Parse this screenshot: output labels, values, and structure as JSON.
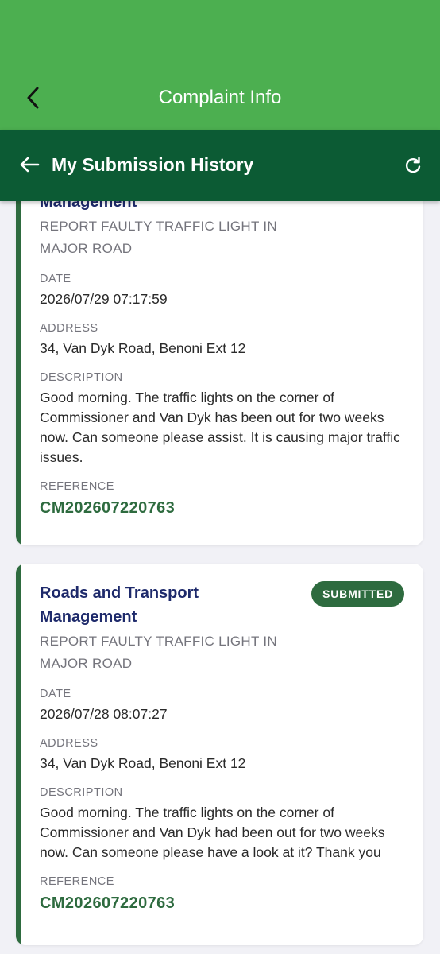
{
  "header": {
    "title": "Complaint Info"
  },
  "subheader": {
    "title": "My Submission History"
  },
  "labels": {
    "date": "DATE",
    "address": "ADDRESS",
    "description": "DESCRIPTION",
    "reference": "REFERENCE"
  },
  "submissions": [
    {
      "department": "Management",
      "status": "",
      "subject": "REPORT FAULTY TRAFFIC LIGHT IN MAJOR ROAD",
      "date": "2026/07/29 07:17:59",
      "address": "34, Van Dyk Road, Benoni Ext 12",
      "description": "Good morning. The traffic lights on the corner of Commissioner and Van Dyk has been out for two weeks now. Can someone please assist. It is causing major traffic issues.",
      "reference": "CM202607220763"
    },
    {
      "department": "Roads and Transport Management",
      "status": "SUBMITTED",
      "subject": "REPORT FAULTY TRAFFIC LIGHT IN MAJOR ROAD",
      "date": "2026/07/28 08:07:27",
      "address": "34, Van Dyk Road, Benoni Ext 12",
      "description": "Good morning. The traffic lights on the corner of Commissioner and Van Dyk had been out for two weeks now. Can someone please have a look at it? Thank you",
      "reference": "CM202607220763"
    }
  ],
  "colors": {
    "header_green": "#4caf50",
    "subheader_green": "#0c5b34",
    "accent_green": "#2e6b3f",
    "department_navy": "#1e2a6b"
  },
  "icons": {
    "back": "chevron-left-icon",
    "sub_back": "arrow-left-icon",
    "refresh": "refresh-icon"
  }
}
